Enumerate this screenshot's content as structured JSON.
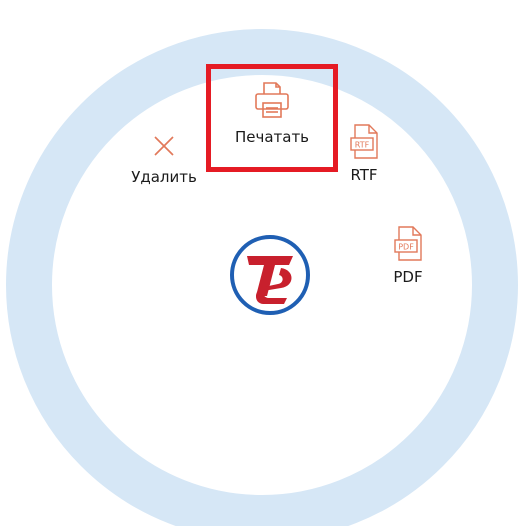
{
  "menu": {
    "print_label": "Печатать",
    "delete_label": "Удалить",
    "rtf_label": "RTF",
    "pdf_label": "PDF",
    "rtf_badge": "RTF",
    "pdf_badge": "PDF"
  },
  "icons": {
    "print": "printer-icon",
    "delete": "close-icon",
    "rtf": "rtf-file-icon",
    "pdf": "pdf-file-icon",
    "logo": "brand-logo-icon"
  },
  "colors": {
    "ring": "#d6e7f6",
    "accent": "#e2795a",
    "selection": "#e51b24",
    "logo_blue": "#1f5fb3",
    "logo_red": "#c8202d"
  }
}
